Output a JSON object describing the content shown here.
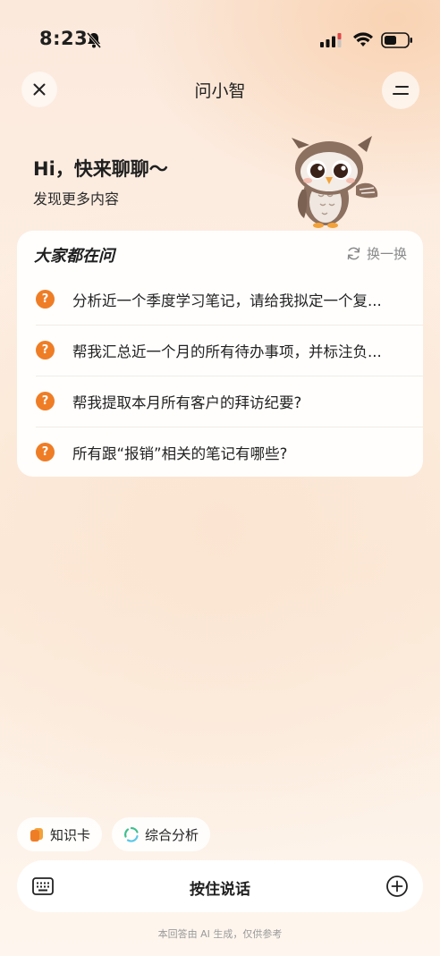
{
  "status_bar": {
    "time": "8:23"
  },
  "nav": {
    "title": "问小智"
  },
  "greeting": {
    "title": "Hi，快来聊聊～",
    "subtitle": "发现更多内容"
  },
  "questions_card": {
    "title": "大家都在问",
    "refresh_label": "换一换",
    "items": [
      {
        "icon": "?",
        "text": "分析近一个季度学习笔记，请给我拟定一个复..."
      },
      {
        "icon": "?",
        "text": "帮我汇总近一个月的所有待办事项，并标注负..."
      },
      {
        "icon": "?",
        "text": "帮我提取本月所有客户的拜访纪要?"
      },
      {
        "icon": "?",
        "text": "所有跟“报销”相关的笔记有哪些?"
      }
    ]
  },
  "chips": [
    {
      "label": "知识卡",
      "icon": "knowledge-card-icon"
    },
    {
      "label": "综合分析",
      "icon": "analysis-icon"
    }
  ],
  "input_bar": {
    "talk_label": "按住说话"
  },
  "disclaimer": "本回答由 AI 生成，仅供参考",
  "colors": {
    "accent": "#ef7d26",
    "background": "#fbe9dc",
    "analysis_green": "#3ebf8f"
  }
}
